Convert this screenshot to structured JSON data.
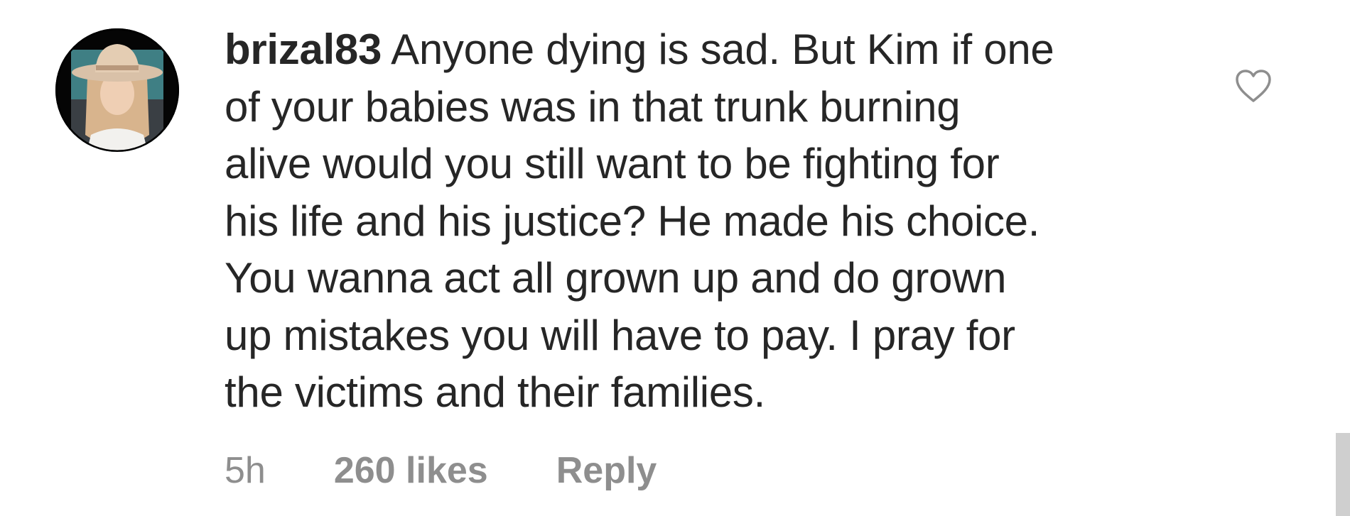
{
  "comment": {
    "username": "brizal83",
    "text_lines": [
      "Anyone dying is sad. But Kim if one",
      "of your babies was in that trunk burning",
      "alive would you still want to be fighting for",
      "his life and his justice? He made his choice.",
      "You wanna act all grown up and do grown",
      "up mistakes you will have to pay. I pray for",
      "the victims and their families."
    ],
    "time": "5h",
    "likes": "260 likes",
    "reply_label": "Reply",
    "like_icon": "heart-outline-icon"
  },
  "colors": {
    "text": "#262626",
    "meta": "#8e8e8e",
    "heart_stroke": "#8e8e8e",
    "scrollbar": "#cfcfcf"
  }
}
